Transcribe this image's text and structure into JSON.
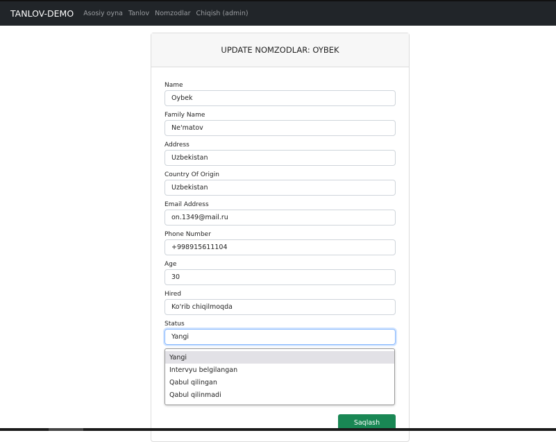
{
  "navbar": {
    "brand": "TANLOV-DEMO",
    "links": [
      "Asosiy oyna",
      "Tanlov",
      "Nomzodlar",
      "Chiqish (admin)"
    ]
  },
  "card": {
    "title": "UPDATE NOMZODLAR: OYBEK"
  },
  "fields": [
    {
      "label": "Name",
      "value": "Oybek"
    },
    {
      "label": "Family Name",
      "value": "Ne'matov"
    },
    {
      "label": "Address",
      "value": "Uzbekistan"
    },
    {
      "label": "Country Of Origin",
      "value": "Uzbekistan"
    },
    {
      "label": "Email Address",
      "value": "on.1349@mail.ru"
    },
    {
      "label": "Phone Number",
      "value": "+998915611104"
    },
    {
      "label": "Age",
      "value": "30"
    },
    {
      "label": "Hired",
      "value": "Ko'rib chiqilmoqda"
    },
    {
      "label": "Status",
      "value": "Yangi"
    }
  ],
  "status_options": [
    "Yangi",
    "Intervyu belgilangan",
    "Qabul qilingan",
    "Qabul qilinmadi"
  ],
  "save_label": "Saqlash",
  "colors": {
    "navbar": "#212529",
    "save_button": "#198754"
  }
}
